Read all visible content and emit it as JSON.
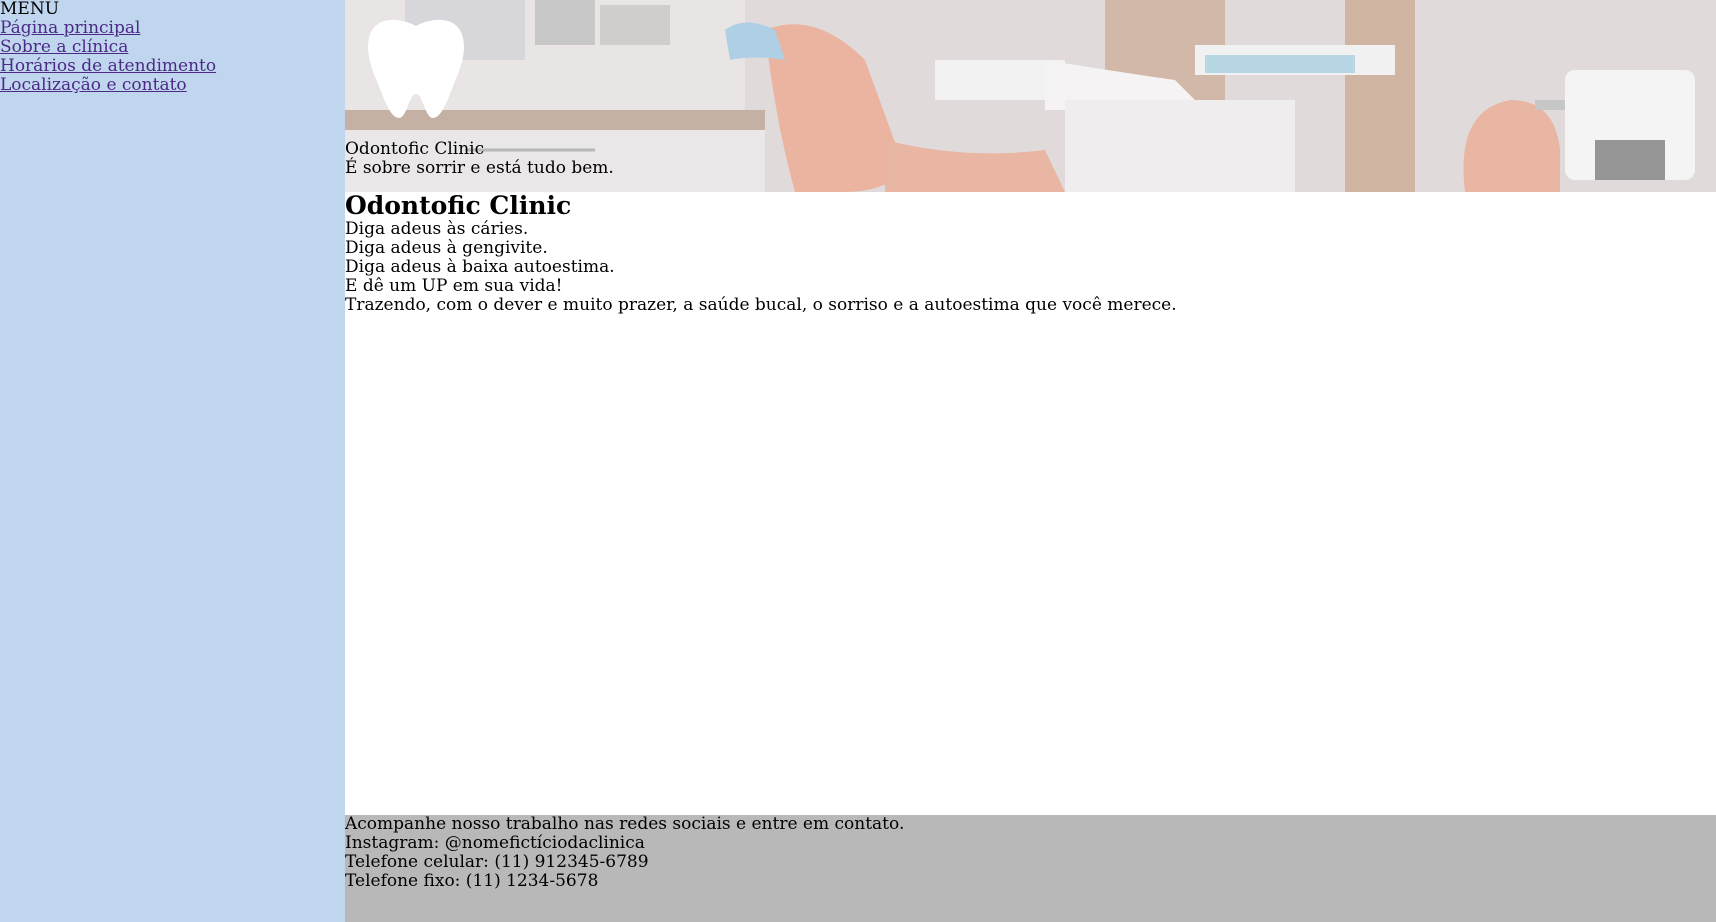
{
  "sidebar": {
    "title": "MENU",
    "items": [
      {
        "label": "Página principal"
      },
      {
        "label": "Sobre a clínica"
      },
      {
        "label": "Horários de atendimento"
      },
      {
        "label": "Localização e contato"
      }
    ]
  },
  "hero": {
    "logo_icon": "tooth-icon",
    "clinic_name": "Odontofic Clinic",
    "tagline": "É sobre sorrir e está tudo bem."
  },
  "main": {
    "heading": "Odontofic Clinic",
    "lines": [
      "Diga adeus às cáries.",
      "Diga adeus à gengivite.",
      "Diga adeus à baixa autoestima.",
      "E dê um UP em sua vida!",
      "Trazendo, com o dever e muito prazer, a saúde bucal, o sorriso e a autoestima que você merece."
    ]
  },
  "footer": {
    "intro": "Acompanhe nosso trabalho nas redes sociais e entre em contato.",
    "instagram": "Instagram: @nomefictíciodaclinica",
    "mobile": "Telefone celular: (11) 912345-6789",
    "landline": "Telefone fixo: (11) 1234-5678"
  },
  "colors": {
    "sidebar_bg": "#c0d6ee",
    "link": "#4b2a86",
    "footer_bg": "#b8b8b8",
    "chair": "#e6a48c"
  }
}
